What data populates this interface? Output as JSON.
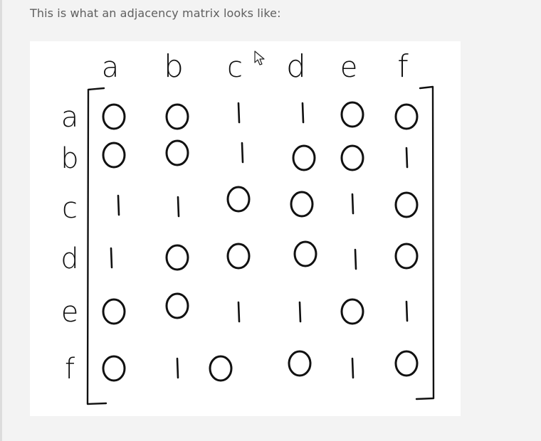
{
  "article": {
    "intro_text": "This is what an adjacency matrix looks like:"
  },
  "matrix": {
    "column_labels": [
      "a",
      "b",
      "c",
      "d",
      "e",
      "f"
    ],
    "row_labels": [
      "a",
      "b",
      "c",
      "d",
      "e",
      "f"
    ],
    "rows": [
      [
        "0",
        "0",
        "1",
        "1",
        "0",
        "0"
      ],
      [
        "0",
        "0",
        "1",
        "0",
        "0",
        "1"
      ],
      [
        "1",
        "1",
        "0",
        "0",
        "1",
        "0"
      ],
      [
        "1",
        "0",
        "0",
        "0",
        "1",
        "0"
      ],
      [
        "0",
        "0",
        "1",
        "1",
        "0",
        "1"
      ],
      [
        "0",
        "1",
        "0",
        "0",
        "1",
        "0"
      ]
    ]
  }
}
